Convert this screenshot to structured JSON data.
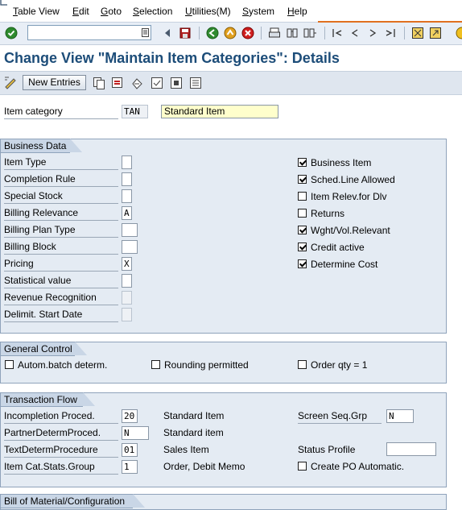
{
  "menu": {
    "items": [
      {
        "pre": "",
        "u": "T",
        "post": "able View"
      },
      {
        "pre": "",
        "u": "E",
        "post": "dit"
      },
      {
        "pre": "",
        "u": "G",
        "post": "oto"
      },
      {
        "pre": "",
        "u": "S",
        "post": "election"
      },
      {
        "pre": "",
        "u": "U",
        "post": "tilities(M)"
      },
      {
        "pre": "",
        "u": "S",
        "post": "ystem"
      },
      {
        "pre": "",
        "u": "H",
        "post": "elp"
      }
    ]
  },
  "toolbar": {
    "command_value": "",
    "icons": [
      "check-icon",
      "back-arrow-icon",
      "save-icon",
      "back-icon",
      "exit-icon",
      "cancel-icon",
      "print-icon",
      "find-icon",
      "find-next-icon",
      "first-page-icon",
      "previous-page-icon",
      "next-page-icon",
      "last-page-icon",
      "create-session-icon",
      "shortcut-icon",
      "help-icon"
    ]
  },
  "page_title": "Change View \"Maintain Item Categories\": Details",
  "app_toolbar": {
    "new_entries_label": "New Entries"
  },
  "header": {
    "item_category_label": "Item category",
    "item_category_value": "TAN",
    "item_category_desc": "Standard Item"
  },
  "business_data": {
    "title": "Business Data",
    "fields": [
      {
        "label": "Item Type",
        "value": ""
      },
      {
        "label": "Completion Rule",
        "value": ""
      },
      {
        "label": "Special Stock",
        "value": ""
      },
      {
        "label": "Billing Relevance",
        "value": "A"
      },
      {
        "label": "Billing Plan Type",
        "value": ""
      },
      {
        "label": "Billing Block",
        "value": ""
      },
      {
        "label": "Pricing",
        "value": "X"
      },
      {
        "label": "Statistical value",
        "value": ""
      },
      {
        "label": "Revenue Recognition",
        "value": ""
      },
      {
        "label": "Delimit. Start Date",
        "value": ""
      }
    ],
    "checkboxes": [
      {
        "label": "Business Item",
        "checked": true
      },
      {
        "label": "Sched.Line Allowed",
        "checked": true
      },
      {
        "label": "Item Relev.for Dlv",
        "checked": false
      },
      {
        "label": "Returns",
        "checked": false
      },
      {
        "label": "Wght/Vol.Relevant",
        "checked": true
      },
      {
        "label": "Credit active",
        "checked": true
      },
      {
        "label": "Determine Cost",
        "checked": true
      }
    ]
  },
  "general_control": {
    "title": "General Control",
    "checkboxes": [
      {
        "label": "Autom.batch determ.",
        "checked": false
      },
      {
        "label": "Rounding permitted",
        "checked": false
      },
      {
        "label": "Order qty = 1",
        "checked": false
      }
    ]
  },
  "transaction_flow": {
    "title": "Transaction Flow",
    "rows": [
      {
        "label": "Incompletion Proced.",
        "value": "20",
        "desc": "Standard Item"
      },
      {
        "label": "PartnerDetermProced.",
        "value": "N",
        "desc": "Standard item"
      },
      {
        "label": "TextDetermProcedure",
        "value": "01",
        "desc": "Sales Item"
      },
      {
        "label": "Item Cat.Stats.Group",
        "value": "1",
        "desc": "Order, Debit Memo"
      }
    ],
    "screen_seq_label": "Screen Seq.Grp",
    "screen_seq_value": "N",
    "status_profile_label": "Status Profile",
    "status_profile_value": "",
    "create_po_label": "Create PO Automatic.",
    "create_po_checked": false
  },
  "bom_group": {
    "title": "Bill of Material/Configuration"
  },
  "colors": {
    "title_blue": "#1d4d79",
    "group_bg": "#e4ebf3",
    "group_title_bg": "#c9d6e6",
    "input_highlight": "#ffffcc",
    "menu_accent": "#e07020"
  }
}
